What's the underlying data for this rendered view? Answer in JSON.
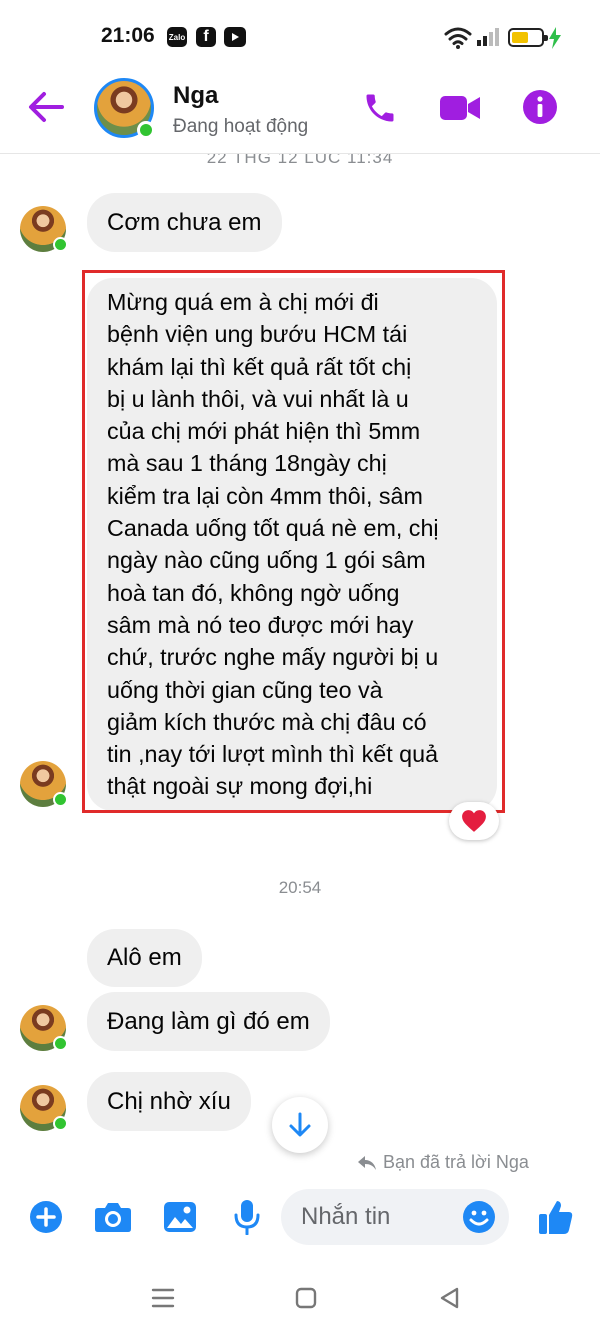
{
  "status_bar": {
    "time": "21:06",
    "app_icons": [
      "zalo-icon",
      "facebook-icon",
      "youtube-icon"
    ],
    "zalo_text": "Zalo",
    "facebook_text": "f"
  },
  "header": {
    "contact_name": "Nga",
    "contact_status": "Đang hoạt động",
    "accent": "#a01ee0"
  },
  "conversation": {
    "earlier_timestamp": "22 THG 12 LÚC 11:34",
    "messages_1": [
      {
        "text": "Cơm chưa em"
      },
      {
        "lines": [
          "Mừng quá em à chị mới đi",
          "bệnh viện ung bướu HCM tái",
          "khám lại thì kết quả rất tốt chị",
          "bị u lành thôi, và vui nhất là u",
          "của chị mới phát hiện thì 5mm",
          "mà sau 1 tháng 18ngày chị",
          "kiểm tra lại còn 4mm thôi, sâm",
          "Canada uống tốt quá nè em, chị",
          "ngày nào cũng uống 1 gói sâm",
          "hoà tan đó, không ngờ uống",
          "sâm mà nó teo được mới hay",
          "chứ, trước nghe mấy người bị u",
          "uống thời gian cũng teo và",
          "giảm kích thước mà chị đâu có",
          "tin ,nay tới lượt mình thì kết quả",
          "thật ngoài sự mong đợi,hi"
        ],
        "reaction": "heart"
      }
    ],
    "timestamp": "20:54",
    "messages_2": [
      {
        "text": "Alô em"
      },
      {
        "text": "Đang làm gì đó em"
      },
      {
        "text": "Chị nhờ xíu"
      }
    ],
    "reply_note": "Bạn đã trả lời Nga",
    "reaction_color": "#e41e3f",
    "highlight_color": "#e02a2a"
  },
  "composer": {
    "placeholder": "Nhắn tin",
    "icon_color": "#1e88f5"
  }
}
